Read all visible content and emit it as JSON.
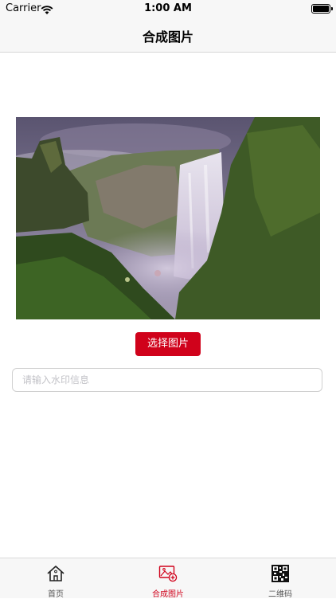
{
  "status_bar": {
    "carrier": "Carrier",
    "time": "1:00 AM"
  },
  "nav": {
    "title": "合成图片"
  },
  "photo": {
    "subject": "waterfall-landscape"
  },
  "actions": {
    "select_image_label": "选择图片"
  },
  "watermark": {
    "placeholder": "请输入水印信息",
    "value": ""
  },
  "tab_bar": {
    "tabs": [
      {
        "label": "首页",
        "icon": "home-icon",
        "active": false
      },
      {
        "label": "合成图片",
        "icon": "image-add-icon",
        "active": true
      },
      {
        "label": "二维码",
        "icon": "qr-code-icon",
        "active": false
      }
    ]
  },
  "colors": {
    "accent": "#d0021b",
    "bar_background": "#f7f7f7"
  }
}
